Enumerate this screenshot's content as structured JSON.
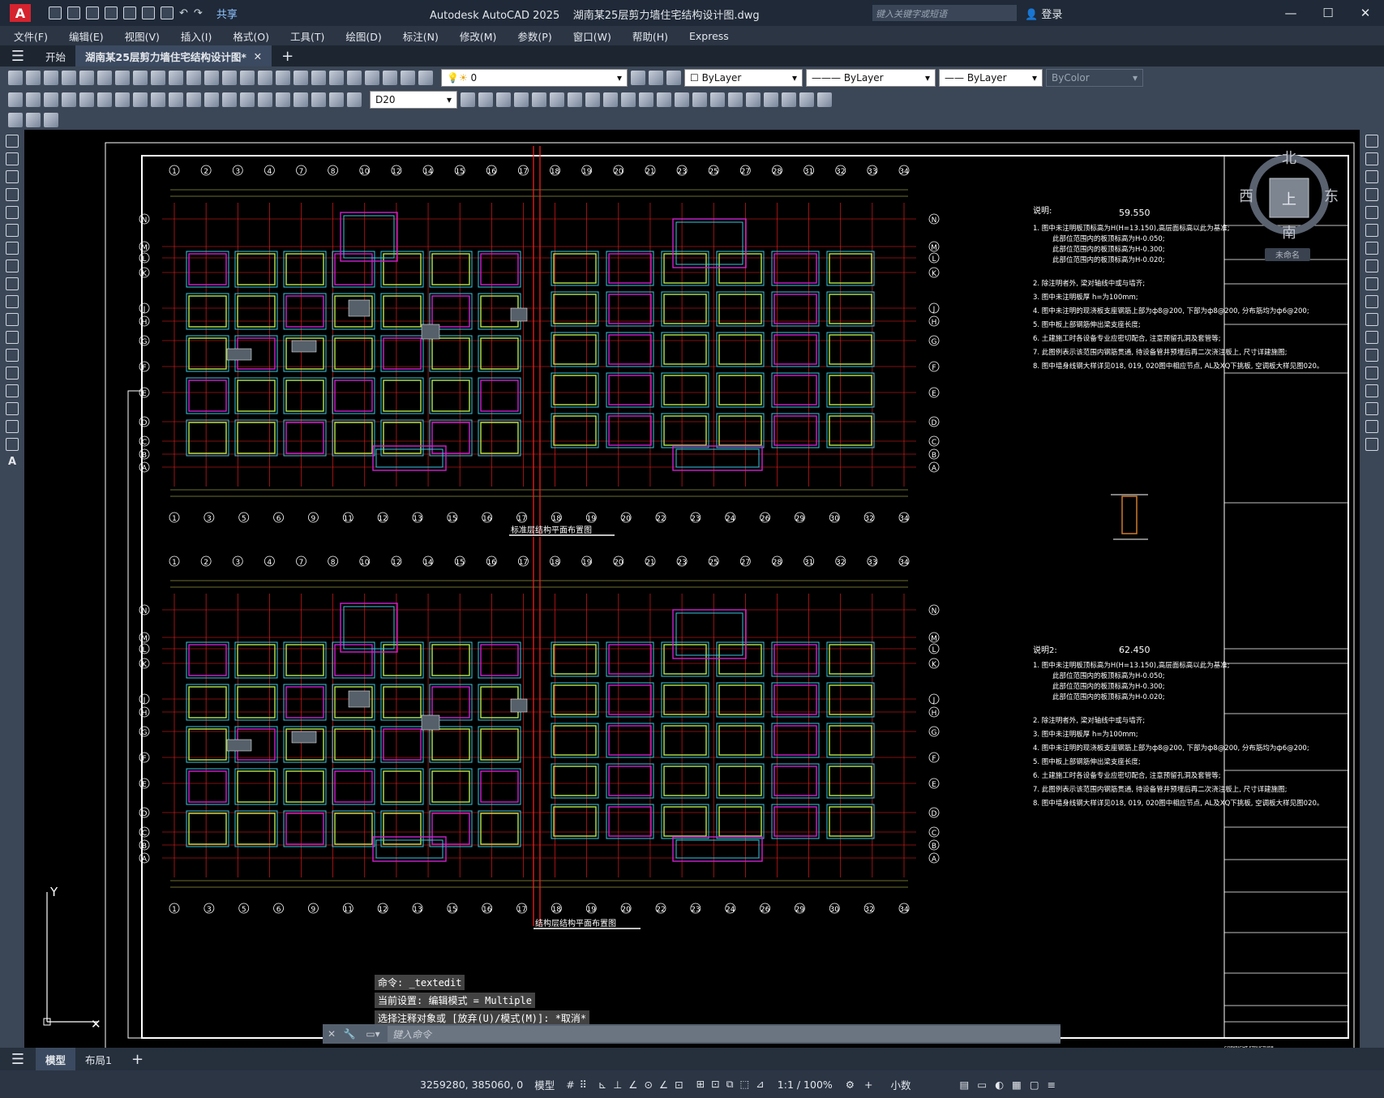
{
  "window": {
    "app_title": "Autodesk AutoCAD 2025",
    "file_title": "湖南某25层剪力墙住宅结构设计图.dwg",
    "share_label": "共享",
    "search_placeholder": "键入关键字或短语",
    "login_label": "登录"
  },
  "menu": [
    "文件(F)",
    "编辑(E)",
    "视图(V)",
    "插入(I)",
    "格式(O)",
    "工具(T)",
    "绘图(D)",
    "标注(N)",
    "修改(M)",
    "参数(P)",
    "窗口(W)",
    "帮助(H)",
    "Express"
  ],
  "doc_tabs": [
    {
      "label": "开始"
    },
    {
      "label": "湖南某25层剪力墙住宅结构设计图*"
    }
  ],
  "toolbar": {
    "layer_value": "0",
    "color_value": "ByLayer",
    "linetype_value": "ByLayer",
    "lineweight_value": "ByLayer",
    "plotstyle_value": "ByColor",
    "dimstyle_value": "D20"
  },
  "viewcube": {
    "north": "北",
    "south": "南",
    "east": "东",
    "west": "西",
    "face": "上",
    "ucs": "未命名"
  },
  "drawing": {
    "plan_title_1": "标准层结构平面布置图",
    "plan_title_2": "结构层结构平面布置图",
    "note_title_1": "说明:",
    "note_elev_1": "59.550",
    "note_title_2": "说明2:",
    "note_elev_2": "62.450",
    "notes": [
      "1. 图中未注明板顶标高为H(H=13.150),高层面标高以此为基准;",
      "此部位范围内的板顶标高为H-0.050;",
      "此部位范围内的板顶标高为H-0.300;",
      "此部位范围内的板顶标高为H-0.020;",
      "2. 除注明者外, 梁对轴线中或与墙齐;",
      "3. 图中未注明板厚 h=为100mm;",
      "4. 图中未注明的现浇板支座钢筋上部为ф8@200, 下部为ф8@200, 分布筋均为ф6@200;",
      "5. 图中板上部钢筋伸出梁支座长度;",
      "6. 土建施工时各设备专业应密切配合, 注意预留孔洞及套管等;",
      "7. 此图例表示该范围内钢筋贯通, 待设备管井预埋后再二次浇注板上, 尺寸详建施图;",
      "8. 图中墙身线钢大样详见018, 019, 020图中相应节点, AL及XQ下挑板, 空调板大样见图020。"
    ],
    "axis_top": [
      "1",
      "2",
      "3",
      "4",
      "7",
      "8",
      "10",
      "12",
      "14",
      "15",
      "16",
      "17",
      "18",
      "19",
      "20",
      "21",
      "23",
      "25",
      "27",
      "28",
      "31",
      "32",
      "33",
      "34"
    ],
    "axis_bottom": [
      "1",
      "3",
      "5",
      "6",
      "9",
      "11",
      "12",
      "13",
      "15",
      "16",
      "17",
      "18",
      "19",
      "20",
      "22",
      "23",
      "24",
      "26",
      "29",
      "30",
      "32",
      "34"
    ],
    "axis_side": [
      "N",
      "M",
      "L",
      "K",
      "J",
      "H",
      "G",
      "F",
      "E",
      "D",
      "C",
      "B",
      "A"
    ],
    "copyright": "COPYRIGHT STRUCTURE"
  },
  "command": {
    "history": [
      "命令: _textedit",
      "当前设置: 编辑模式 = Multiple",
      "选择注释对象或 [放弃(U)/模式(M)]: *取消*"
    ],
    "input_placeholder": "键入命令"
  },
  "layout_tabs": [
    {
      "label": "模型"
    },
    {
      "label": "布局1"
    }
  ],
  "status": {
    "coords": "3259280, 385060, 0",
    "space": "模型",
    "scale": "1:1 / 100%",
    "units": "小数"
  },
  "colors": {
    "accent": "#d5232f",
    "drawing_bg": "#000000",
    "wall": "#b7e84a",
    "beam": "#d020d0",
    "axis": "#ff2020",
    "slab": "#35c8e0"
  }
}
